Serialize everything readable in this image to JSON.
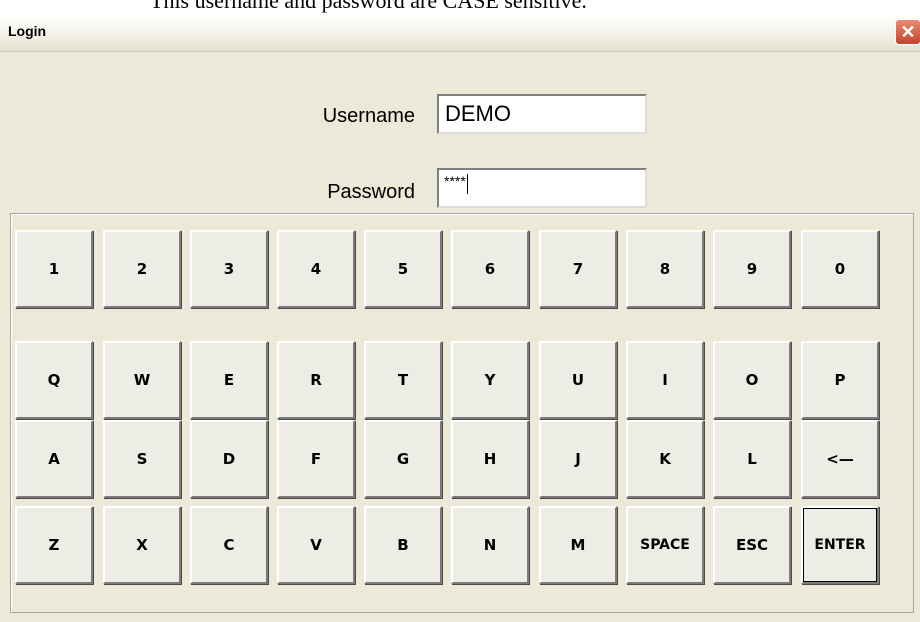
{
  "caption": "This username and password are CASE sensitive.",
  "window": {
    "title": "Login",
    "close_symbol": "✕"
  },
  "form": {
    "username_label": "Username",
    "username_value": "DEMO",
    "password_label": "Password",
    "password_value": "****"
  },
  "keypad": {
    "row1": [
      "1",
      "2",
      "3",
      "4",
      "5",
      "6",
      "7",
      "8",
      "9",
      "0"
    ],
    "row2": [
      "Q",
      "W",
      "E",
      "R",
      "T",
      "Y",
      "U",
      "I",
      "O",
      "P"
    ],
    "row3": [
      "A",
      "S",
      "D",
      "F",
      "G",
      "H",
      "J",
      "K",
      "L",
      "<—"
    ],
    "row4": [
      "Z",
      "X",
      "C",
      "V",
      "B",
      "N",
      "M",
      "SPACE",
      "ESC",
      "ENTER"
    ]
  },
  "colors": {
    "window_bg": "#ece9d8",
    "close_button": "#c7442b"
  },
  "icons": {
    "close": "close-icon",
    "backspace": "backspace-arrow"
  }
}
